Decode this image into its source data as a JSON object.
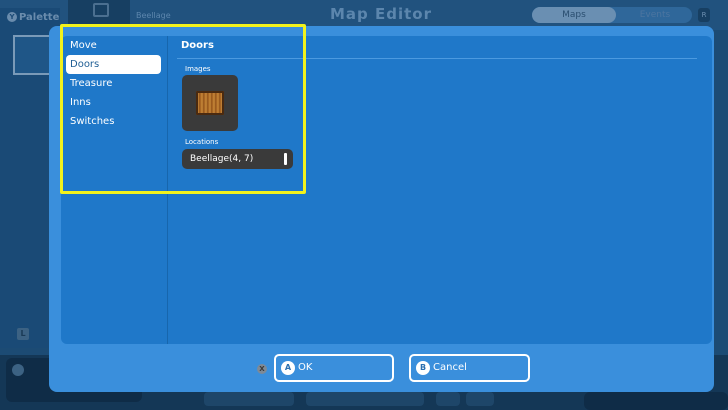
{
  "background": {
    "title": "Map Editor",
    "map_name": "Beellage",
    "tabs": [
      "Maps",
      "Events"
    ],
    "right_badge": "R",
    "palette_label": "Palette",
    "palette_badge": "Y",
    "layer_badge": "L"
  },
  "dialog": {
    "menu": {
      "items": [
        {
          "label": "Move",
          "selected": false
        },
        {
          "label": "Doors",
          "selected": true
        },
        {
          "label": "Treasure",
          "selected": false
        },
        {
          "label": "Inns",
          "selected": false
        },
        {
          "label": "Switches",
          "selected": false
        }
      ]
    },
    "content": {
      "title": "Doors",
      "images_label": "Images",
      "image_icon": "door-icon",
      "locations_label": "Locations",
      "location_value": "Beellage(4, 7)"
    },
    "buttons": {
      "x_badge": "X",
      "ok_badge": "A",
      "ok_label": "OK",
      "cancel_badge": "B",
      "cancel_label": "Cancel"
    }
  },
  "colors": {
    "dialog": "#3a8fdc",
    "panel": "#1f78c9",
    "highlight": "#f2f21c",
    "selected_item_text": "#1f5e94"
  }
}
